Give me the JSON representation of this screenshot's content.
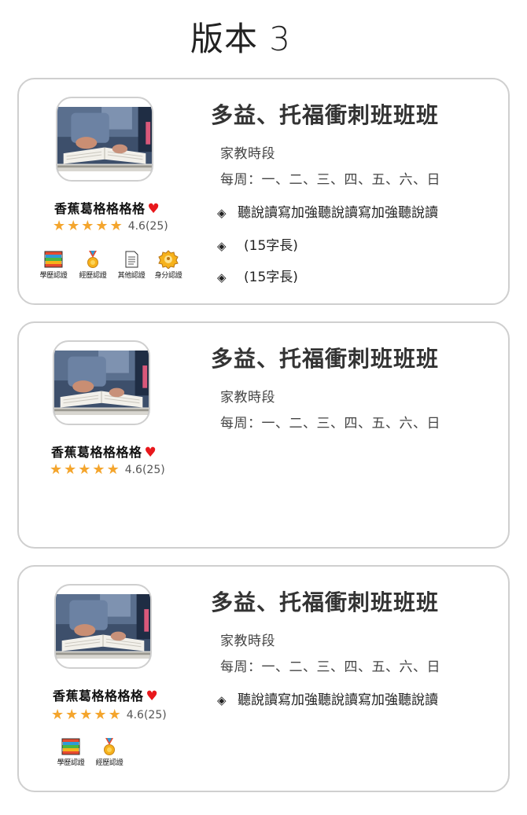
{
  "page": {
    "title": "版本 3"
  },
  "colors": {
    "star": "#f4a52d",
    "heart": "#e8181c",
    "border": "#cfcfcf"
  },
  "cards": [
    {
      "teacher_name": "香蕉葛格格格格",
      "rating_stars": 5,
      "rating_text": "4.6(25)",
      "badges": [
        {
          "icon": "books-icon",
          "label": "學歷認證"
        },
        {
          "icon": "medal-icon",
          "label": "經歷認證"
        },
        {
          "icon": "document-icon",
          "label": "其他認證"
        },
        {
          "icon": "id-badge-icon",
          "label": "身分認證"
        }
      ],
      "course_title": "多益、托福衝刺班班班",
      "time_label": "家教時段",
      "schedule": "每周：一、二、三、四、五、六、日",
      "bullets": [
        "聽說讀寫加強聽說讀寫加強聽說讀",
        "(15字長)",
        "(15字長)"
      ]
    },
    {
      "teacher_name": "香蕉葛格格格格",
      "rating_stars": 5,
      "rating_text": "4.6(25)",
      "badges": [],
      "course_title": "多益、托福衝刺班班班",
      "time_label": "家教時段",
      "schedule": "每周：一、二、三、四、五、六、日",
      "bullets": []
    },
    {
      "teacher_name": "香蕉葛格格格格",
      "rating_stars": 5,
      "rating_text": "4.6(25)",
      "badges": [
        {
          "icon": "books-icon",
          "label": "學歷認證"
        },
        {
          "icon": "medal-icon",
          "label": "經歷認證"
        }
      ],
      "course_title": "多益、托福衝刺班班班",
      "time_label": "家教時段",
      "schedule": "每周：一、二、三、四、五、六、日",
      "bullets": [
        "聽說讀寫加強聽說讀寫加強聽說讀"
      ]
    }
  ]
}
